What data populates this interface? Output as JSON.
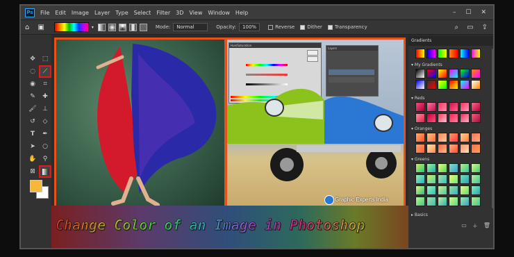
{
  "menubar": {
    "logo": "Ps",
    "items": [
      "File",
      "Edit",
      "Image",
      "Layer",
      "Type",
      "Select",
      "Filter",
      "3D",
      "View",
      "Window",
      "Help"
    ],
    "window_controls": [
      "–",
      "☐",
      "✕"
    ]
  },
  "options_bar": {
    "mode_label": "Mode:",
    "mode_value": "Normal",
    "opacity_label": "Opacity:",
    "opacity_value": "100%",
    "reverse_label": "Reverse",
    "dither_label": "Dither",
    "transparency_label": "Transparency"
  },
  "dialogs": {
    "hue_title": "Hue/Saturation",
    "layers_title": "Layers"
  },
  "watermark": "Graphic Experts India",
  "banner": {
    "text": "Change Color of an Image in Photoshop"
  },
  "gradients_panel": {
    "tab": "Gradients",
    "groups": [
      "My Gradients",
      "Reds",
      "Oranges",
      "Greens",
      "Basics"
    ]
  },
  "colors": {
    "accent_border": "#e8521a",
    "highlight": "#e81818",
    "foreground": "#f4b93a",
    "background": "#ffffff"
  },
  "icons": [
    "home-icon",
    "move-icon",
    "marquee-icon",
    "lasso-icon",
    "gradient-icon",
    "crop-icon",
    "eyedropper-icon",
    "brush-icon",
    "stamp-icon",
    "eraser-icon",
    "pen-icon",
    "type-icon",
    "hand-icon",
    "zoom-icon",
    "search-icon",
    "settings-icon"
  ]
}
